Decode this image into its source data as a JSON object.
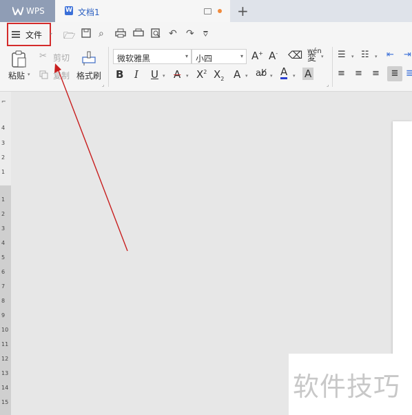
{
  "titlebar": {
    "app_name": "WPS",
    "doc_tab": "文档1",
    "new_tab": "+"
  },
  "ribbon": {
    "file_menu": "文件",
    "paste": "粘贴",
    "cut": "剪切",
    "copy": "复制",
    "format_painter": "格式刷",
    "font_family": "微软雅黑",
    "font_size": "小四"
  },
  "ruler": {
    "top_numbers": [
      "4",
      "3",
      "2",
      "1"
    ],
    "numbers": [
      "1",
      "2",
      "3",
      "4",
      "5",
      "6",
      "7",
      "8",
      "9",
      "10",
      "11",
      "12",
      "13",
      "14",
      "15"
    ]
  },
  "watermark": "软件技巧",
  "colors": {
    "annotation_red": "#d42a2a",
    "accent_blue": "#2a5fc2"
  }
}
